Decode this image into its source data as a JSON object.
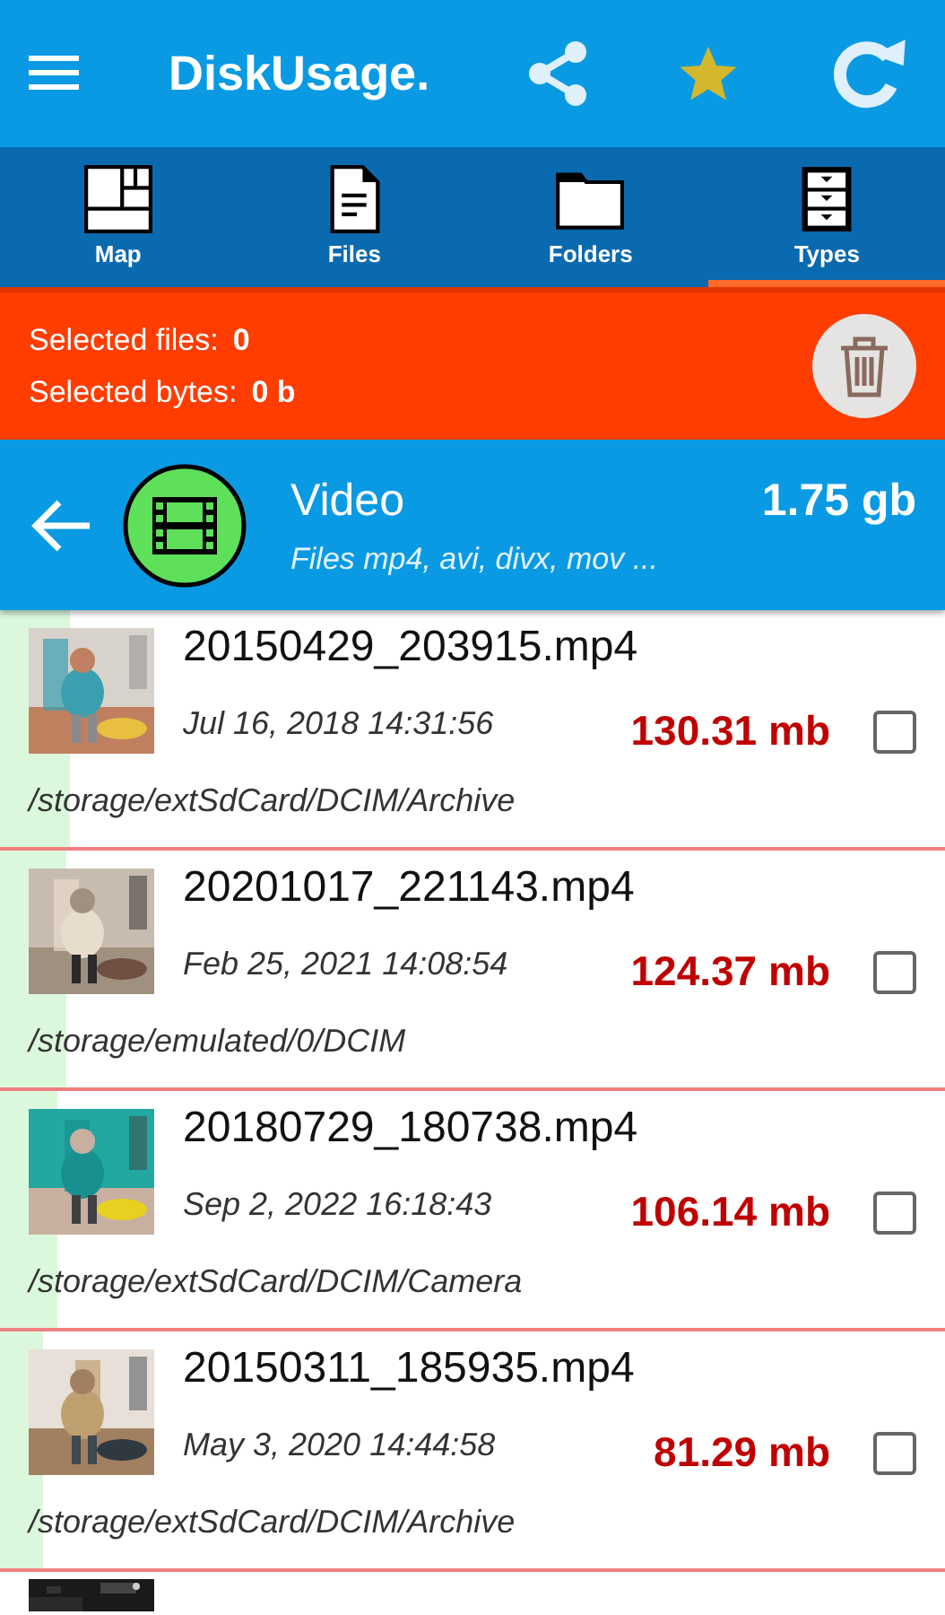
{
  "app_bar": {
    "title": "DiskUsage."
  },
  "tabs": [
    {
      "label": "Map",
      "kind": "map",
      "selected": false
    },
    {
      "label": "Files",
      "kind": "files",
      "selected": false
    },
    {
      "label": "Folders",
      "kind": "folders",
      "selected": false
    },
    {
      "label": "Types",
      "kind": "types",
      "selected": true
    }
  ],
  "selection_bar": {
    "files_label": "Selected files:",
    "files_value": "0",
    "bytes_label": "Selected bytes:",
    "bytes_value": "0 b"
  },
  "category": {
    "title": "Video",
    "subtitle": "Files mp4, avi, divx, mov ...",
    "total": "1.75 gb"
  },
  "files": [
    {
      "name": "20150429_203915.mp4",
      "date": "Jul 16, 2018 14:31:56",
      "size": "130.31 mb",
      "path": "/storage/extSdCard/DCIM/Archive",
      "checked": false,
      "level": 0.074,
      "kind": "picture"
    },
    {
      "name": "20201017_221143.mp4",
      "date": "Feb 25, 2021 14:08:54",
      "size": "124.37 mb",
      "path": "/storage/emulated/0/DCIM",
      "checked": false,
      "level": 0.071,
      "kind": "picture"
    },
    {
      "name": "20180729_180738.mp4",
      "date": "Sep 2, 2022 16:18:43",
      "size": "106.14 mb",
      "path": "/storage/extSdCard/DCIM/Camera",
      "checked": false,
      "level": 0.061,
      "kind": "picture"
    },
    {
      "name": "20150311_185935.mp4",
      "date": "May 3, 2020 14:44:58",
      "size": "81.29 mb",
      "path": "/storage/extSdCard/DCIM/Archive",
      "checked": false,
      "level": 0.046,
      "kind": "picture"
    }
  ]
}
